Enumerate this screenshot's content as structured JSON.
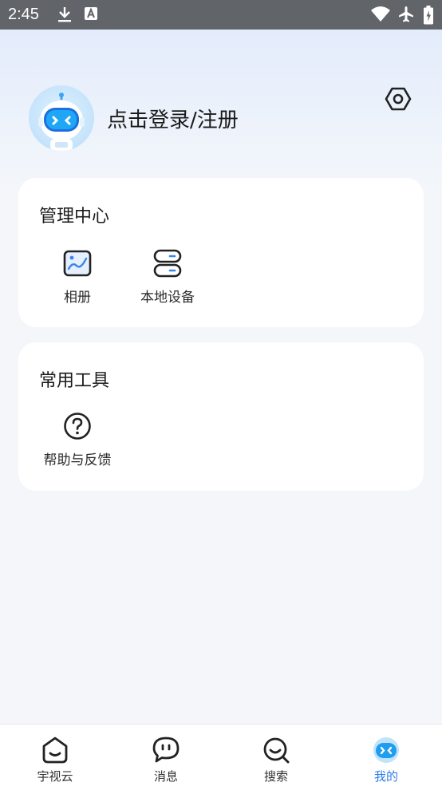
{
  "status_bar": {
    "time": "2:45"
  },
  "profile": {
    "login_label": "点击登录/注册"
  },
  "management": {
    "title": "管理中心",
    "items": [
      {
        "label": "相册",
        "icon": "album-icon"
      },
      {
        "label": "本地设备",
        "icon": "local-device-icon"
      }
    ]
  },
  "tools": {
    "title": "常用工具",
    "items": [
      {
        "label": "帮助与反馈",
        "icon": "help-icon"
      }
    ]
  },
  "tabbar": {
    "tabs": [
      {
        "label": "宇视云",
        "icon": "cloud-home-icon"
      },
      {
        "label": "消息",
        "icon": "message-icon"
      },
      {
        "label": "搜索",
        "icon": "search-icon"
      },
      {
        "label": "我的",
        "icon": "robot-face-icon",
        "active": true
      }
    ]
  },
  "colors": {
    "accent": "#2b7de9",
    "status_bar": "#616468",
    "card": "#ffffff"
  }
}
